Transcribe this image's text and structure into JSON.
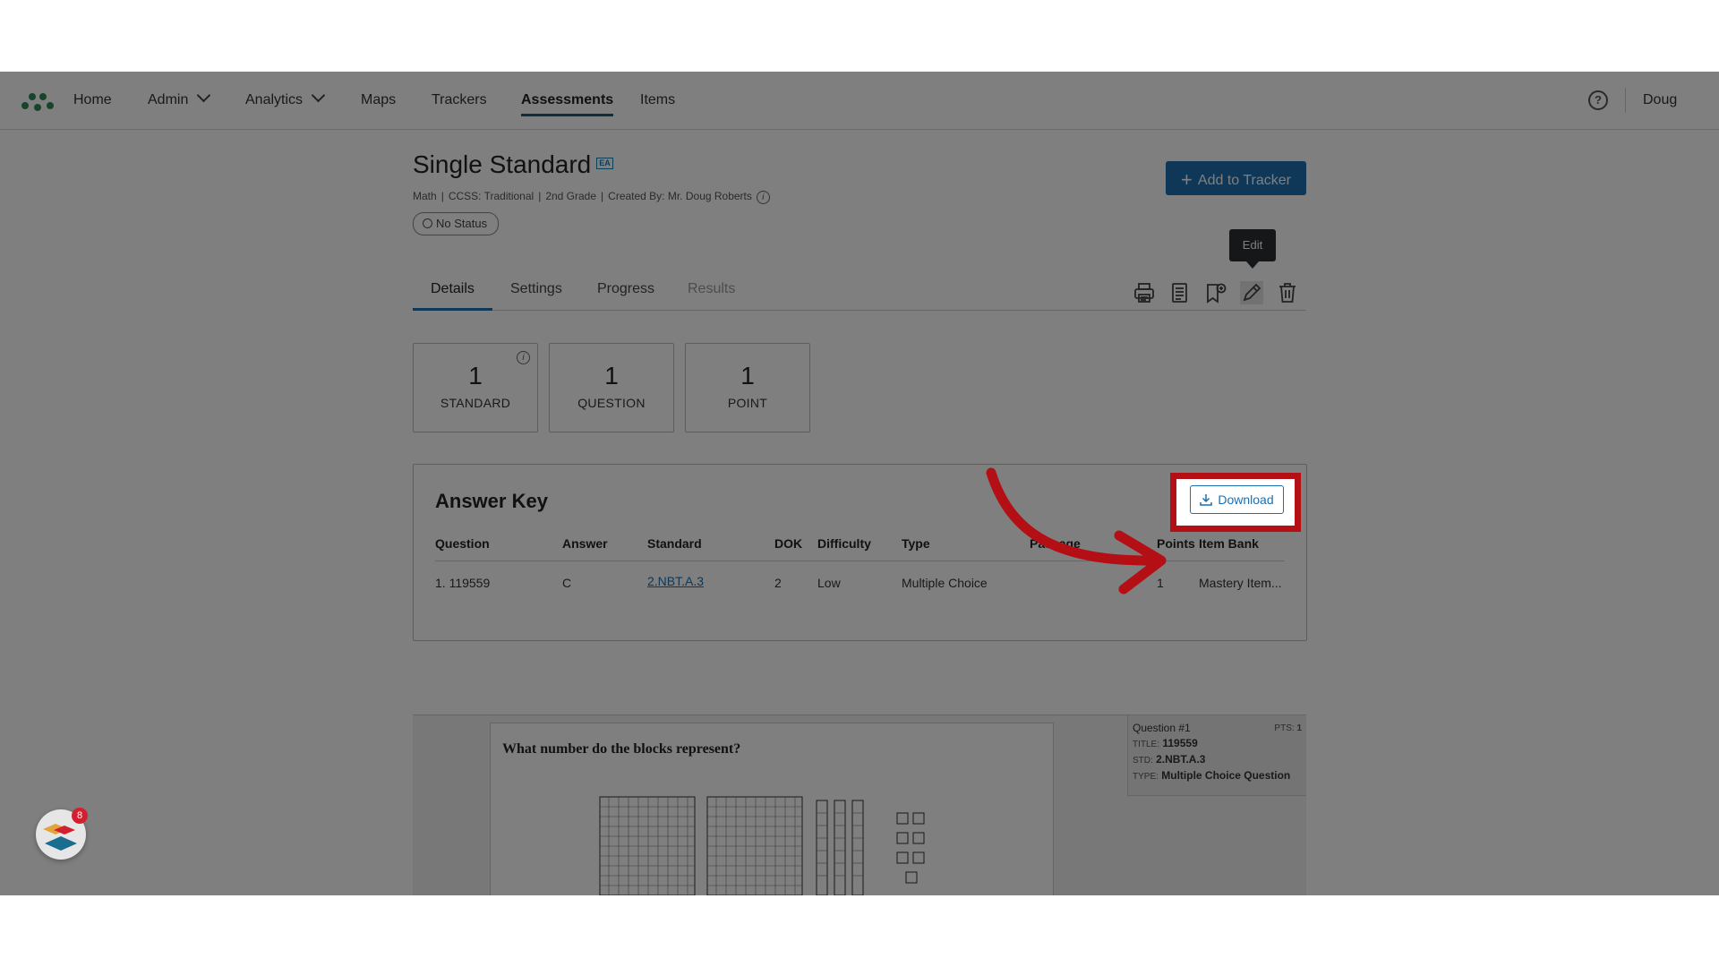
{
  "nav": {
    "items": [
      "Home",
      "Admin",
      "Analytics",
      "Maps",
      "Trackers",
      "Assessments",
      "Items"
    ],
    "active": "Assessments",
    "help_icon": "?",
    "user": "Doug"
  },
  "assessment": {
    "title": "Single Standard",
    "title_badge": "EA",
    "meta": {
      "subject": "Math",
      "framework": "CCSS: Traditional",
      "grade": "2nd Grade",
      "created_by": "Created By: Mr. Doug Roberts"
    },
    "status": "No Status",
    "add_button": "Add to Tracker"
  },
  "tabs": [
    "Details",
    "Settings",
    "Progress",
    "Results"
  ],
  "tooltip": "Edit",
  "stats": [
    {
      "value": "1",
      "label": "STANDARD"
    },
    {
      "value": "1",
      "label": "QUESTION"
    },
    {
      "value": "1",
      "label": "POINT"
    }
  ],
  "answer_key": {
    "title": "Answer Key",
    "download": "Download",
    "columns": [
      "Question",
      "Answer",
      "Standard",
      "DOK",
      "Difficulty",
      "Type",
      "Passage",
      "Points",
      "Item Bank"
    ],
    "rows": [
      {
        "question": "1. 119559",
        "answer": "C",
        "standard": "2.NBT.A.3",
        "dok": "2",
        "difficulty": "Low",
        "type": "Multiple Choice",
        "passage": "",
        "points": "1",
        "item_bank": "Mastery Item..."
      }
    ]
  },
  "preview": {
    "question_text": "What number do the blocks represent?",
    "side": {
      "heading": "Question #1",
      "pts_label": "PTS:",
      "pts_value": "1",
      "title_label": "TITLE:",
      "title_value": "119559",
      "std_label": "STD:",
      "std_value": "2.NBT.A.3",
      "type_label": "TYPE:",
      "type_value": "Multiple Choice Question"
    }
  },
  "notification_count": "8",
  "colors": {
    "primary": "#1c6fb0",
    "highlight": "#b30f15",
    "overlay": "rgba(0,0,0,0.5)"
  }
}
